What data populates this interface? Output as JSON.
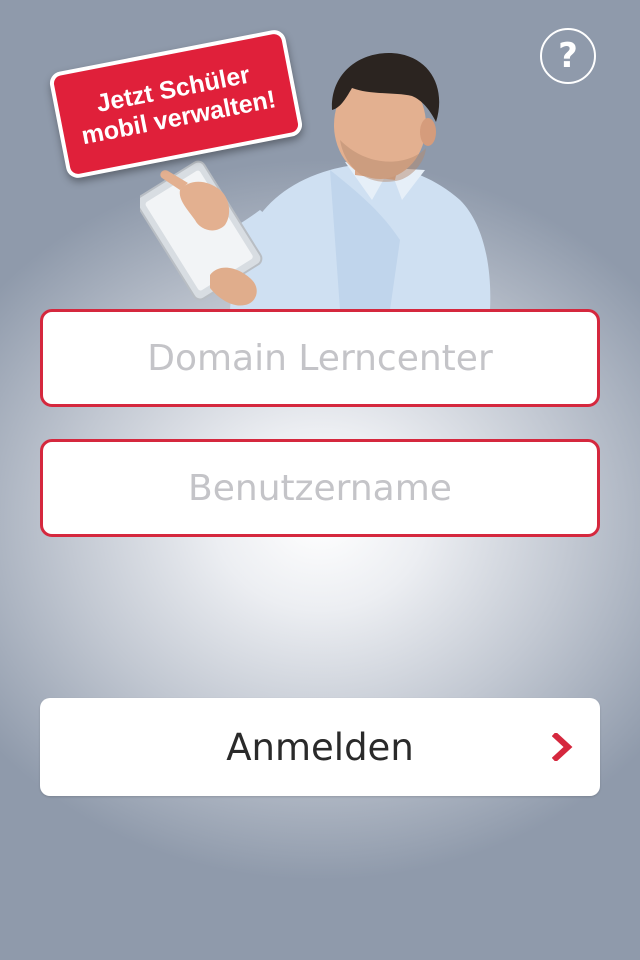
{
  "header": {
    "help_label": "?",
    "help_icon": "help-icon"
  },
  "promo": {
    "line1": "Jetzt Schüler",
    "line2": "mobil verwalten!",
    "color": "#e0203a"
  },
  "form": {
    "domain": {
      "placeholder": "Domain Lerncenter",
      "value": ""
    },
    "username": {
      "placeholder": "Benutzername",
      "value": ""
    },
    "submit_label": "Anmelden",
    "submit_icon": "chevron-right-icon",
    "accent_color": "#d5283e"
  }
}
